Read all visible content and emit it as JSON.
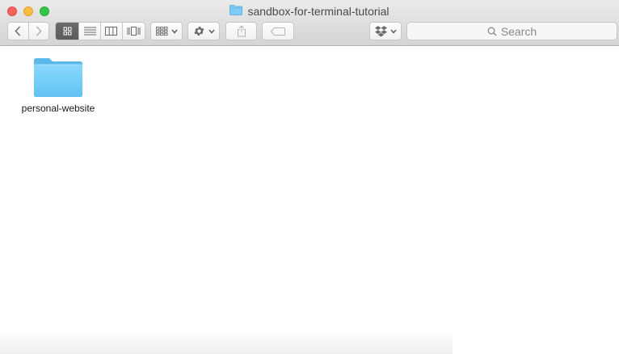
{
  "window": {
    "title": "sandbox-for-terminal-tutorial",
    "title_icon": "folder-icon"
  },
  "toolbar": {
    "back_icon": "chevron-left-icon",
    "forward_icon": "chevron-right-icon",
    "view_modes": [
      "icon-view",
      "list-view",
      "column-view",
      "cover-flow-view"
    ],
    "active_view": "icon-view",
    "arrange_icon": "arrange-grid-icon",
    "action_icon": "gear-icon",
    "share_icon": "share-icon",
    "tags_icon": "tag-icon",
    "dropbox_icon": "dropbox-icon"
  },
  "search": {
    "placeholder": "Search"
  },
  "files": [
    {
      "name": "personal-website",
      "kind": "folder"
    }
  ],
  "colors": {
    "folder": "#6cc8f5",
    "close": "#fc605c",
    "minimize": "#fdbc40",
    "maximize": "#34c84a"
  }
}
